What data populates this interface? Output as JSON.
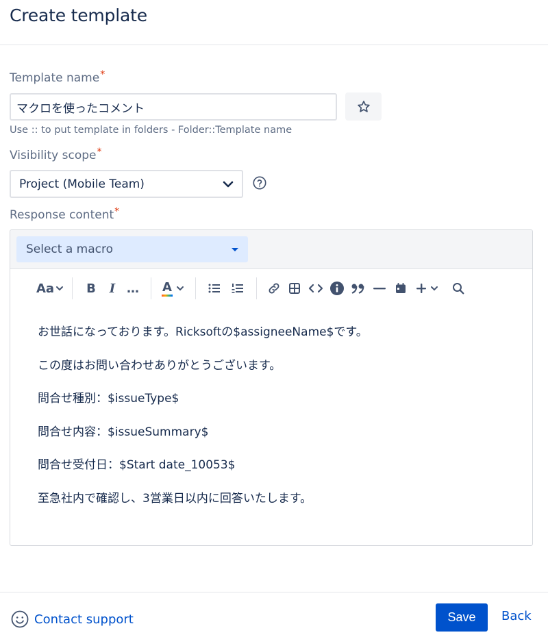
{
  "page": {
    "title": "Create template"
  },
  "form": {
    "template_name": {
      "label": "Template name",
      "required_mark": "*",
      "value": "マクロを使ったコメント",
      "helper": "Use :: to put template in folders - Folder::Template name",
      "favorite_icon": "star-icon"
    },
    "visibility": {
      "label": "Visibility scope",
      "required_mark": "*",
      "selected": "Project (Mobile Team)",
      "help_icon": "question-circle-icon"
    },
    "response": {
      "label": "Response content",
      "required_mark": "*",
      "macro_placeholder": "Select a macro"
    }
  },
  "toolbar": {
    "text_style_label": "Aa",
    "bold": "B",
    "italic": "I",
    "more": "…",
    "text_color": "A",
    "icons": [
      "chevron-down-icon",
      "bullet-list-icon",
      "numbered-list-icon",
      "link-icon",
      "table-icon",
      "code-icon",
      "info-icon",
      "quote-icon",
      "divider-icon",
      "date-icon",
      "insert-icon",
      "search-icon"
    ]
  },
  "editor": {
    "paragraphs": [
      "お世話になっております。Ricksoftの$assigneeName$です。",
      "この度はお問い合わせありがとうございます。",
      "問合せ種別：$issueType$",
      "問合せ内容：$issueSummary$",
      "問合せ受付日：$Start date_10053$",
      "至急社内で確認し、3営業日以内に回答いたします。"
    ]
  },
  "footer": {
    "support_label": "Contact support",
    "save_label": "Save",
    "back_label": "Back"
  },
  "colors": {
    "primary": "#0052cc",
    "required": "#de350b",
    "text": "#172b4d",
    "subtle": "#5e6c84",
    "macro_bg": "#deebff"
  }
}
